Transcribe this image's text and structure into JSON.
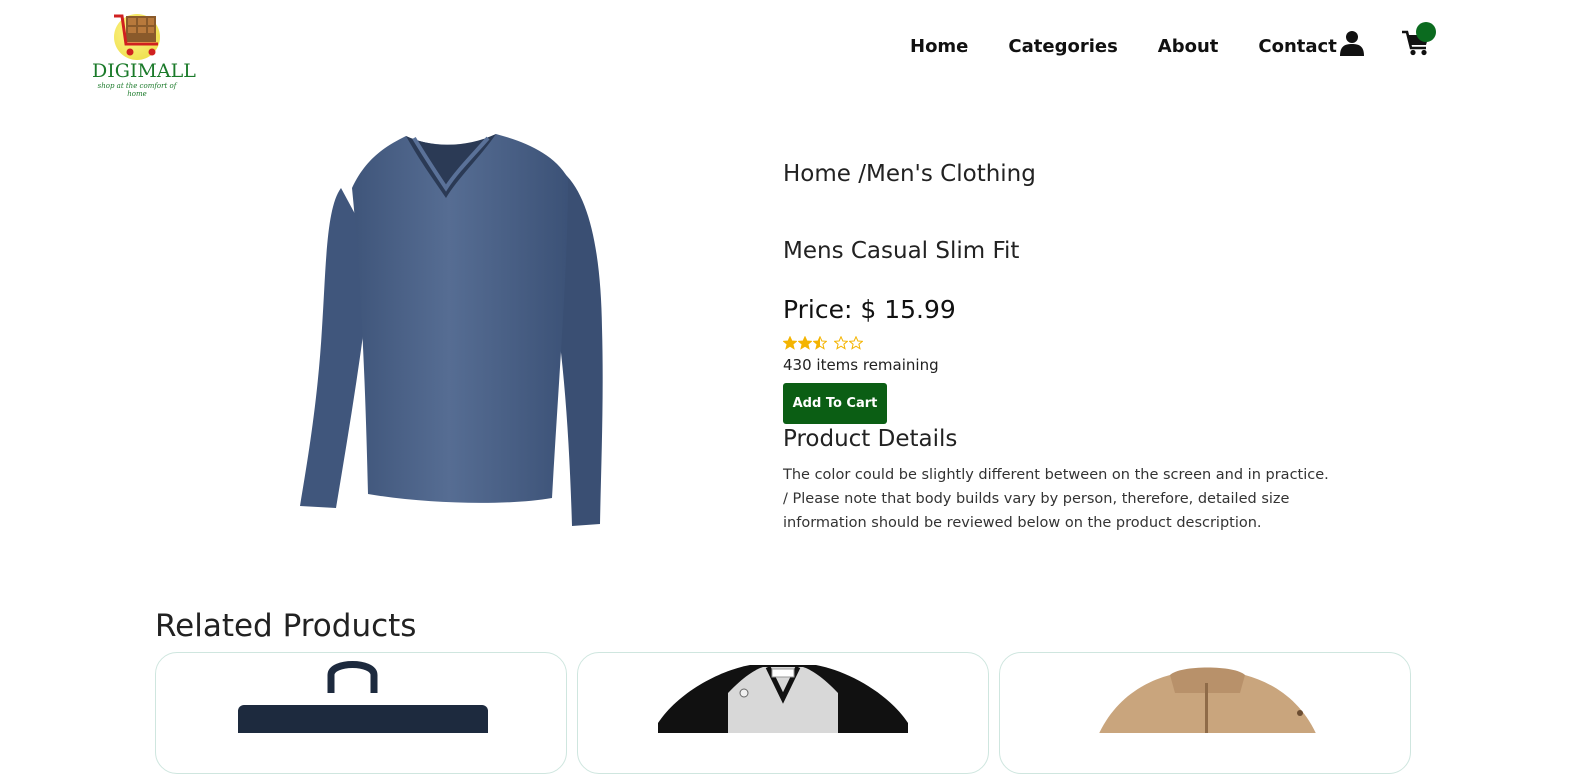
{
  "brand": {
    "name": "DIGIMALL",
    "tagline": "shop at the comfort of home"
  },
  "nav": {
    "items": [
      "Home",
      "Categories",
      "About",
      "Contact"
    ],
    "icons": [
      "user-icon",
      "cart-icon"
    ]
  },
  "product": {
    "breadcrumb": "Home /Men's Clothing",
    "title": "Mens Casual Slim Fit",
    "price": "Price: $ 15.99",
    "rating": 2.5,
    "rating_max": 5,
    "stock": "430 items remaining",
    "add_to_cart_label": "Add To Cart",
    "details_heading": "Product Details",
    "details_text": "The color could be slightly different between on the screen and in practice. / Please note that body builds vary by person, therefore, detailed size information should be reviewed below on the product description."
  },
  "related": {
    "heading": "Related Products",
    "items": [
      "backpack",
      "raglan-shirt",
      "jacket"
    ]
  },
  "colors": {
    "accent": "#0b5e14",
    "cart_badge": "#0b6b1f",
    "star": "#f4b400",
    "shirt": "#4d6388",
    "brand_green": "#1b7a2a"
  }
}
